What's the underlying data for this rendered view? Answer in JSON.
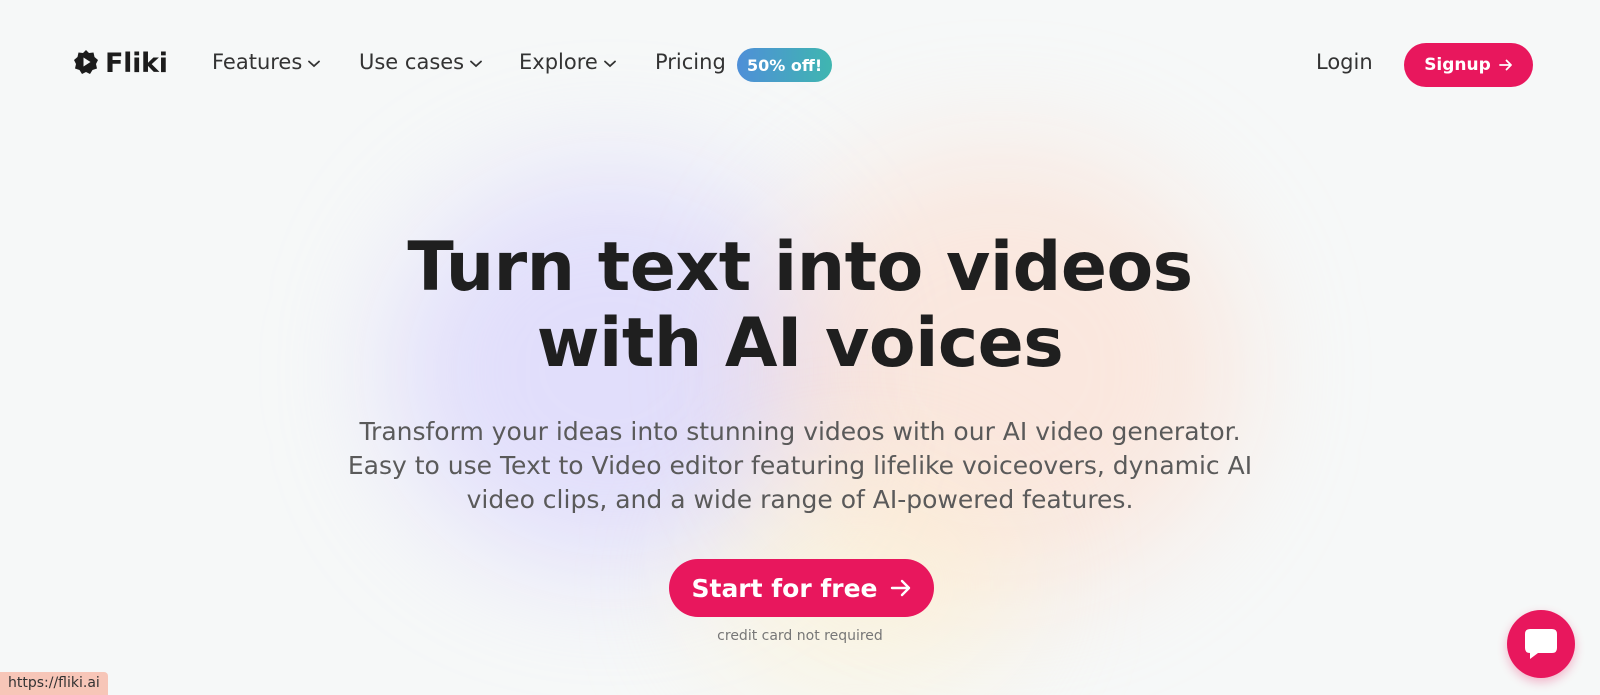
{
  "nav": {
    "logo_text": "Fliki",
    "items": [
      {
        "label": "Features"
      },
      {
        "label": "Use cases"
      },
      {
        "label": "Explore"
      },
      {
        "label": "Pricing"
      }
    ],
    "pricing_badge": "50% off!",
    "login_label": "Login",
    "signup_label": "Signup"
  },
  "hero": {
    "title_line1": "Turn text into videos",
    "title_line2": "with AI voices",
    "subtitle": "Transform your ideas into stunning videos with our AI video generator. Easy to use Text to Video editor featuring lifelike voiceovers, dynamic AI video clips, and a wide range of AI-powered features.",
    "cta_label": "Start for free",
    "cta_note": "credit card not required"
  },
  "status_url": "https://fliki.ai",
  "colors": {
    "brand": "#e8175d",
    "badge_gradient_start": "#4f8fd8",
    "badge_gradient_end": "#3fb6b0",
    "background": "#f6f8f8"
  },
  "icons": {
    "logo": "play-badge-icon",
    "dropdown": "chevron-down-icon",
    "arrow": "arrow-right-icon",
    "chat": "chat-bubble-icon"
  }
}
